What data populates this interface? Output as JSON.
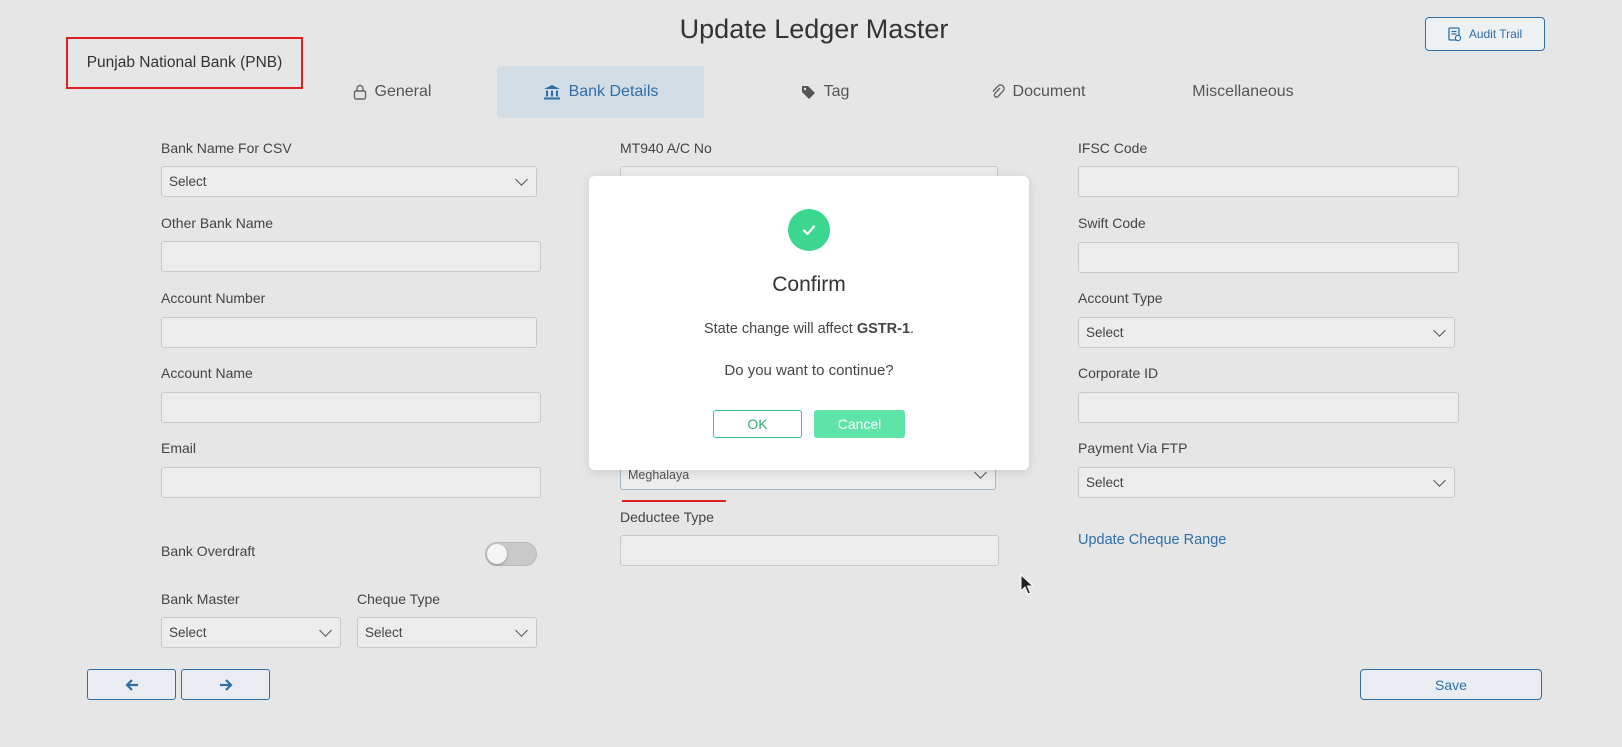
{
  "header": {
    "title": "Update Ledger Master",
    "audit_trail_label": "Audit Trail",
    "ledger_name": "Punjab National Bank (PNB)"
  },
  "tabs": [
    {
      "label": "General",
      "icon": "lock-icon"
    },
    {
      "label": "Bank Details",
      "icon": "bank-icon",
      "active": true
    },
    {
      "label": "Tag",
      "icon": "tag-icon"
    },
    {
      "label": "Document",
      "icon": "paperclip-icon"
    },
    {
      "label": "Miscellaneous"
    }
  ],
  "form": {
    "bank_name_csv": {
      "label": "Bank Name For CSV",
      "value": "Select"
    },
    "other_bank_name": {
      "label": "Other Bank Name",
      "value": ""
    },
    "account_number": {
      "label": "Account Number",
      "value": ""
    },
    "account_name": {
      "label": "Account Name",
      "value": ""
    },
    "email": {
      "label": "Email",
      "value": ""
    },
    "bank_overdraft": {
      "label": "Bank Overdraft",
      "on": false
    },
    "bank_master": {
      "label": "Bank Master",
      "value": "Select"
    },
    "cheque_type": {
      "label": "Cheque Type",
      "value": "Select"
    },
    "mt940": {
      "label": "MT940 A/C No",
      "value": ""
    },
    "state": {
      "value": "Meghalaya"
    },
    "deductee_type": {
      "label": "Deductee Type",
      "value": ""
    },
    "ifsc": {
      "label": "IFSC Code",
      "value": ""
    },
    "swift": {
      "label": "Swift Code",
      "value": ""
    },
    "account_type": {
      "label": "Account Type",
      "value": "Select"
    },
    "corporate_id": {
      "label": "Corporate ID",
      "value": ""
    },
    "payment_ftp": {
      "label": "Payment Via FTP",
      "value": "Select"
    },
    "update_cheque_range": "Update Cheque Range"
  },
  "footer": {
    "save_label": "Save"
  },
  "modal": {
    "title": "Confirm",
    "message_prefix": "State change will affect ",
    "message_bold": "GSTR-1",
    "message_suffix": ".",
    "question": "Do you want to continue?",
    "ok_label": "OK",
    "cancel_label": "Cancel"
  },
  "colors": {
    "accent": "#2f6fa8",
    "success": "#3bd68f",
    "highlight_red": "#e02020"
  }
}
